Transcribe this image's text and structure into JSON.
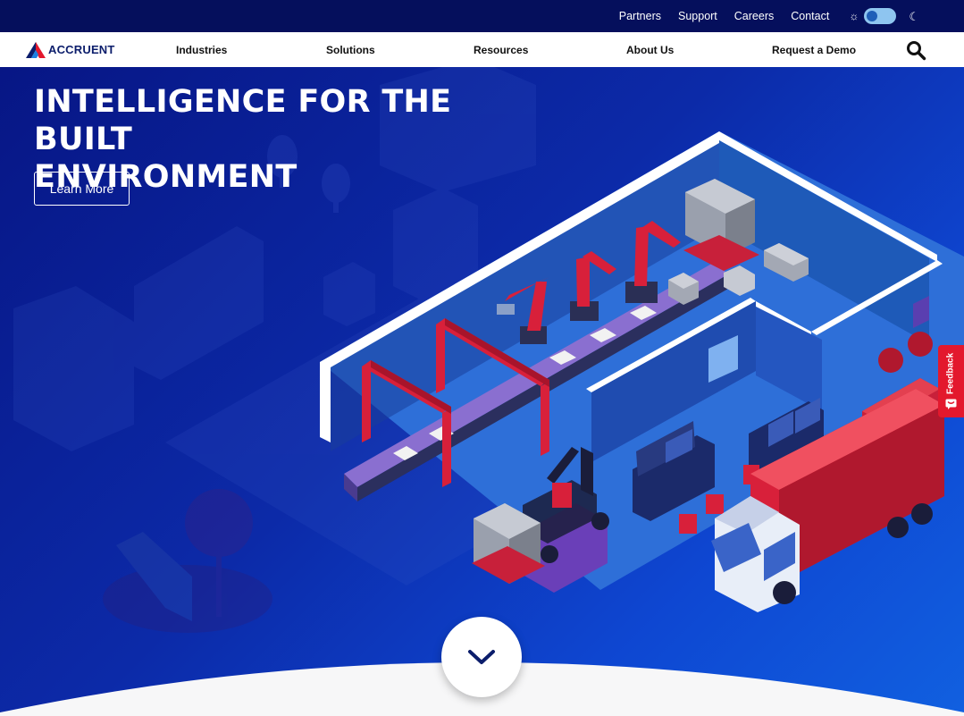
{
  "topbar": {
    "links": [
      "Partners",
      "Support",
      "Careers",
      "Contact"
    ]
  },
  "theme_toggle": {
    "sun_icon": "sun-icon",
    "moon_icon": "moon-icon",
    "state": "light"
  },
  "brand": {
    "logo_text": "ACCRUENT"
  },
  "nav": {
    "items": [
      "Industries",
      "Solutions",
      "Resources",
      "About Us",
      "Request a Demo"
    ],
    "search_icon": "search-icon"
  },
  "hero": {
    "title_line1": "INTELLIGENCE FOR THE BUILT",
    "title_line2": "ENVIRONMENT",
    "cta_label": "Learn More",
    "scroll_icon": "chevron-down-icon"
  },
  "feedback": {
    "label": "Feedback",
    "icon": "feedback-icon"
  },
  "colors": {
    "topbar": "#050f5c",
    "hero_dark": "#071685",
    "hero_light": "#1160e0",
    "accent_red": "#e3182d",
    "brand_navy": "#0b1d6b"
  }
}
